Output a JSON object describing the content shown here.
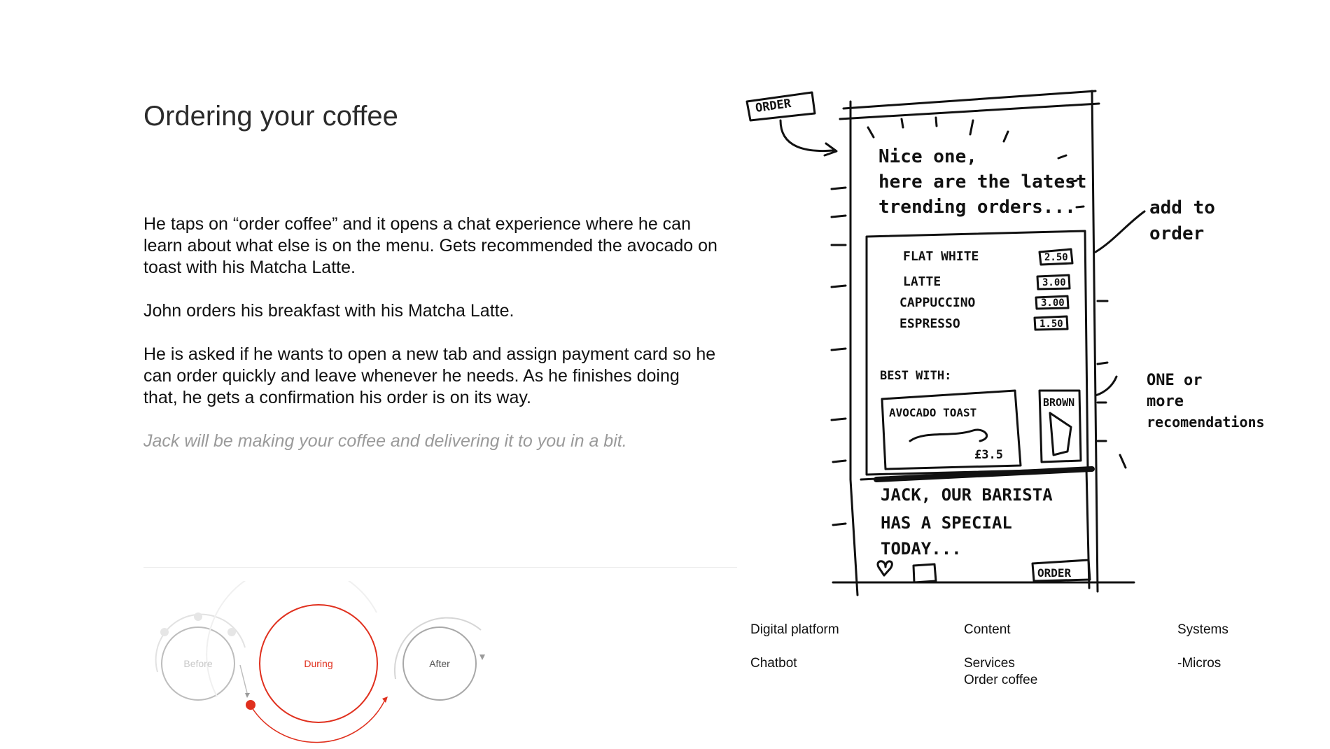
{
  "title": "Ordering your coffee",
  "paragraphs": [
    "He taps on “order coffee” and it opens a chat experience where he can learn about what else is on the menu. Gets recommended the avocado on toast with his Matcha Latte.",
    "John orders his breakfast with his Matcha Latte.",
    "He is asked if he wants to open a new tab and assign payment card so he can order quickly and leave whenever he needs. As he finishes doing that, he gets a confirmation his order is on its way."
  ],
  "quote": "Jack will be making your coffee and delivering it to you in a bit.",
  "journey": {
    "before": "Before",
    "during": "During",
    "after": "After",
    "active_color": "#e0301e",
    "inactive_color": "#bdbdbd"
  },
  "sketch": {
    "order_tag": "ORDER",
    "greeting": [
      "Nice one,",
      "here are the latest",
      "trending orders..."
    ],
    "menu": [
      {
        "name": "FLAT WHITE",
        "price": "2.50"
      },
      {
        "name": "LATTE",
        "price": "3.00"
      },
      {
        "name": "CAPPUCCINO",
        "price": "3.00"
      },
      {
        "name": "ESPRESSO",
        "price": "1.50"
      }
    ],
    "best_with": "BEST WITH:",
    "rec1": "AVOCADO TOAST",
    "rec1_price": "£3.5",
    "rec2": "BROWN",
    "barista": [
      "JACK, OUR BARISTA",
      "HAS A SPECIAL",
      "TODAY..."
    ],
    "order_button": "ORDER",
    "note_add": [
      "add to",
      "order"
    ],
    "note_recs": [
      "ONE or",
      "more",
      "recomendations"
    ]
  },
  "columns": [
    {
      "heading": "Digital platform",
      "values": [
        "Chatbot"
      ]
    },
    {
      "heading": "Content",
      "values": [
        "Services",
        "Order coffee"
      ]
    },
    {
      "heading": "Systems",
      "values": [
        "-Micros"
      ]
    }
  ]
}
